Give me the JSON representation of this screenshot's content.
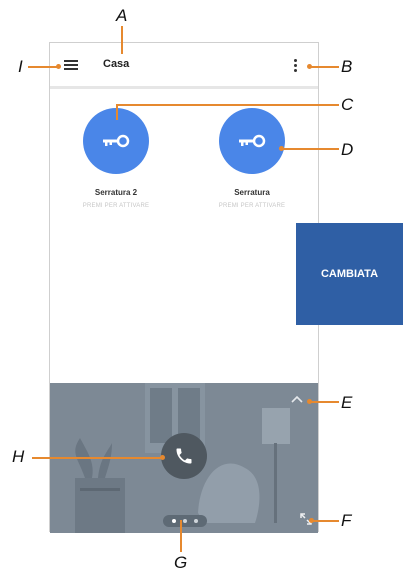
{
  "app": {
    "title": "Casa"
  },
  "locks": [
    {
      "name": "Serratura 2",
      "hint": "PREMI PER ATTIVARE"
    },
    {
      "name": "Serratura",
      "hint": "PREMI PER ATTIVARE"
    }
  ],
  "overlay": {
    "label": "CAMBIATA"
  },
  "callouts": {
    "a": "A",
    "b": "B",
    "c": "C",
    "d": "D",
    "e": "E",
    "f": "F",
    "g": "G",
    "h": "H",
    "i": "I"
  },
  "pager": {
    "pages": 3,
    "active": 1
  },
  "colors": {
    "accent_blue": "#4a86e8",
    "leader_orange": "#e6892f",
    "overlay_blue": "#2f5fa5",
    "video_bg": "#7e8a96"
  },
  "icons": [
    "menu-icon",
    "more-vert-icon",
    "key-icon",
    "chevron-up-icon",
    "phone-icon",
    "expand-icon"
  ]
}
